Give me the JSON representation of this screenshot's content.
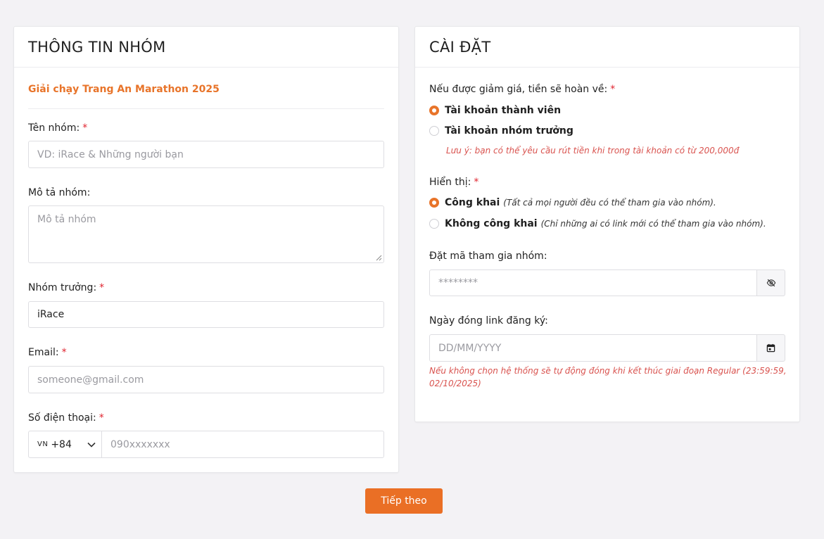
{
  "group_info": {
    "title": "THÔNG TIN NHÓM",
    "event_name": "Giải chạy Trang An Marathon 2025",
    "group_name": {
      "label": "Tên nhóm:",
      "required_mark": "*",
      "placeholder": "VD: iRace & Những người bạn",
      "value": ""
    },
    "description": {
      "label": "Mô tả nhóm:",
      "placeholder": "Mô tả nhóm",
      "value": ""
    },
    "leader": {
      "label": "Nhóm trưởng:",
      "required_mark": "*",
      "value": "iRace"
    },
    "email": {
      "label": "Email:",
      "required_mark": "*",
      "placeholder": "someone@gmail.com",
      "value": ""
    },
    "phone": {
      "label": "Số điện thoại:",
      "required_mark": "*",
      "country_flag": "VN",
      "country_code": "+84",
      "placeholder": "090xxxxxxx",
      "value": ""
    }
  },
  "settings": {
    "title": "CÀI ĐẶT",
    "refund": {
      "label": "Nếu được giảm giá, tiền sẽ hoàn về:",
      "required_mark": "*",
      "options": [
        {
          "label": "Tài khoản thành viên",
          "selected": true
        },
        {
          "label": "Tài khoản nhóm trưởng",
          "selected": false
        }
      ],
      "note": "Lưu ý: bạn có thể yêu cầu rút tiền khi trong tài khoản có từ 200,000đ"
    },
    "visibility": {
      "label": "Hiển thị:",
      "required_mark": "*",
      "options": [
        {
          "label": "Công khai",
          "note": "(Tất cả mọi người đều có thể tham gia vào nhóm).",
          "selected": true
        },
        {
          "label": "Không công khai",
          "note": "(Chỉ những ai có link mới có thể tham gia vào nhóm).",
          "selected": false
        }
      ]
    },
    "join_code": {
      "label": "Đặt mã tham gia nhóm:",
      "placeholder": "********",
      "icon": "eye-off-icon"
    },
    "close_date": {
      "label": "Ngày đóng link đăng ký:",
      "placeholder": "DD/MM/YYYY",
      "icon": "calendar-icon",
      "note": "Nếu không chọn hệ thống sẽ tự động đóng khi kết thúc giai đoạn Regular (23:59:59, 02/10/2025)"
    }
  },
  "actions": {
    "next_label": "Tiếp theo"
  },
  "colors": {
    "accent": "#e8742a",
    "required": "#e0242f",
    "note": "#d9534f",
    "background": "#f3f2f5"
  }
}
